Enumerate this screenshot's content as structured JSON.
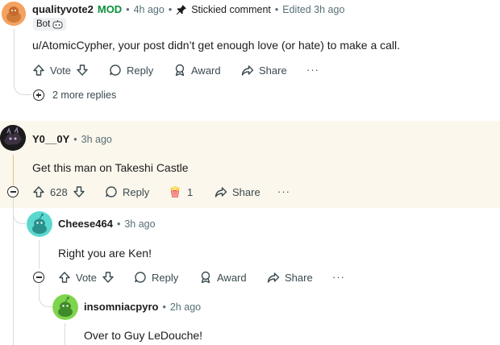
{
  "comments": [
    {
      "username": "qualityvote2",
      "mod_label": "MOD",
      "time": "4h ago",
      "sep": "•",
      "stickied": "Stickied comment",
      "edited": "Edited 3h ago",
      "flair": "Bot",
      "body": "u/AtomicCypher, your post didn’t get enough love (or hate) to make a call.",
      "vote_label": "Vote",
      "reply_label": "Reply",
      "award_label": "Award",
      "share_label": "Share",
      "more_replies": "2 more replies"
    },
    {
      "username": "Y0__0Y",
      "time": "3h ago",
      "sep": "•",
      "body": "Get this man on Takeshi Castle",
      "score": "628",
      "reply_label": "Reply",
      "award_count": "1",
      "share_label": "Share"
    },
    {
      "username": "Cheese464",
      "time": "3h ago",
      "sep": "•",
      "body": "Right you are Ken!",
      "vote_label": "Vote",
      "reply_label": "Reply",
      "award_label": "Award",
      "share_label": "Share"
    },
    {
      "username": "insomniacpyro",
      "time": "2h ago",
      "sep": "•",
      "body": "Over to Guy LeDouche!"
    }
  ],
  "overflow_label": "···",
  "colors": {
    "mod_green": "#0a8f3c",
    "highlight_bg": "#fbf7ec",
    "thread_line": "#d6dadd",
    "avatar_orange": "#f4a261",
    "avatar_cyan": "#5ad8d0",
    "avatar_green": "#7fd44e"
  }
}
